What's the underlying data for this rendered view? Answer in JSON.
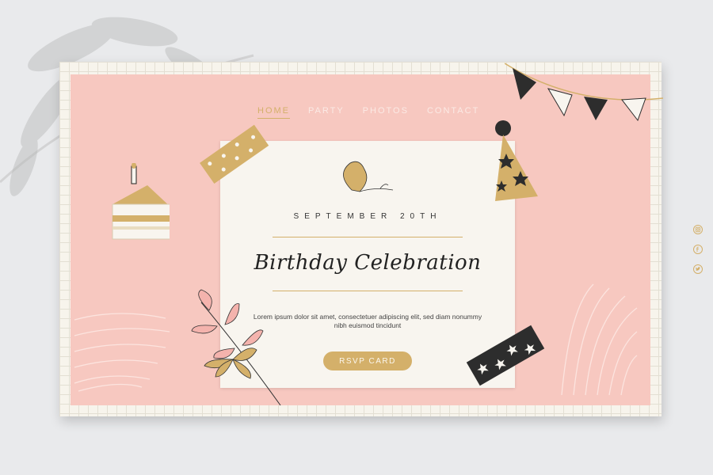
{
  "nav": {
    "items": [
      "HOME",
      "PARTY",
      "PHOTOS",
      "CONTACT"
    ],
    "active": "HOME"
  },
  "card": {
    "date": "SEPTEMBER 20TH",
    "title": "Birthday Celebration",
    "body": "Lorem ipsum dolor sit amet, consectetuer adipiscing elit, sed diam nonummy nibh euismod tincidunt",
    "button": "RSVP CARD"
  },
  "social": [
    "instagram-icon",
    "facebook-icon",
    "twitter-icon"
  ],
  "colors": {
    "background": "#e9eaec",
    "pink": "#f7c8c0",
    "card": "#f8f5ef",
    "gold": "#d4b06a",
    "dark": "#2d2d2d"
  }
}
